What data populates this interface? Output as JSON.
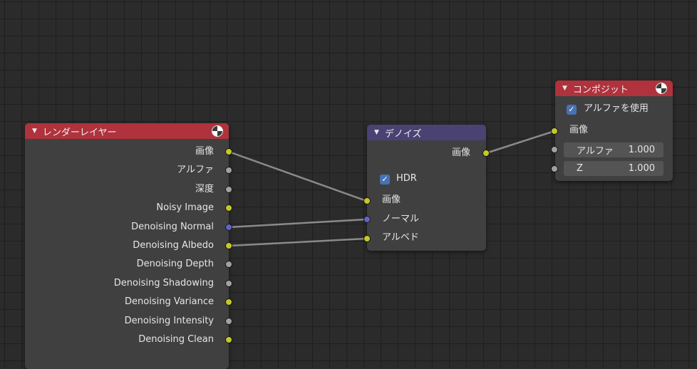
{
  "render_layers_node": {
    "title": "レンダーレイヤー",
    "outputs": [
      {
        "label": "画像",
        "socket": "yellow"
      },
      {
        "label": "アルファ",
        "socket": "gray"
      },
      {
        "label": "深度",
        "socket": "gray"
      },
      {
        "label": "Noisy Image",
        "socket": "yellow"
      },
      {
        "label": "Denoising Normal",
        "socket": "blue"
      },
      {
        "label": "Denoising Albedo",
        "socket": "yellow"
      },
      {
        "label": "Denoising Depth",
        "socket": "gray"
      },
      {
        "label": "Denoising Shadowing",
        "socket": "gray"
      },
      {
        "label": "Denoising Variance",
        "socket": "yellow"
      },
      {
        "label": "Denoising Intensity",
        "socket": "gray"
      },
      {
        "label": "Denoising Clean",
        "socket": "yellow"
      }
    ]
  },
  "denoise_node": {
    "title": "デノイズ",
    "output_label": "画像",
    "hdr_label": "HDR",
    "hdr_checked": true,
    "inputs": [
      {
        "label": "画像",
        "socket": "yellow"
      },
      {
        "label": "ノーマル",
        "socket": "blue"
      },
      {
        "label": "アルベド",
        "socket": "yellow"
      }
    ]
  },
  "composite_node": {
    "title": "コンポジット",
    "use_alpha_label": "アルファを使用",
    "use_alpha_checked": true,
    "image_label": "画像",
    "alpha_label": "アルファ",
    "alpha_value": "1.000",
    "z_label": "Z",
    "z_value": "1.000"
  },
  "colors": {
    "background": "#2b2b2b",
    "node_body": "#404040",
    "header_red": "#b0323c",
    "header_purple": "#4a4273",
    "socket_yellow": "#c7c729",
    "socket_gray": "#a1a1a1",
    "socket_blue": "#6363c7",
    "link": "#8a8a8a"
  }
}
